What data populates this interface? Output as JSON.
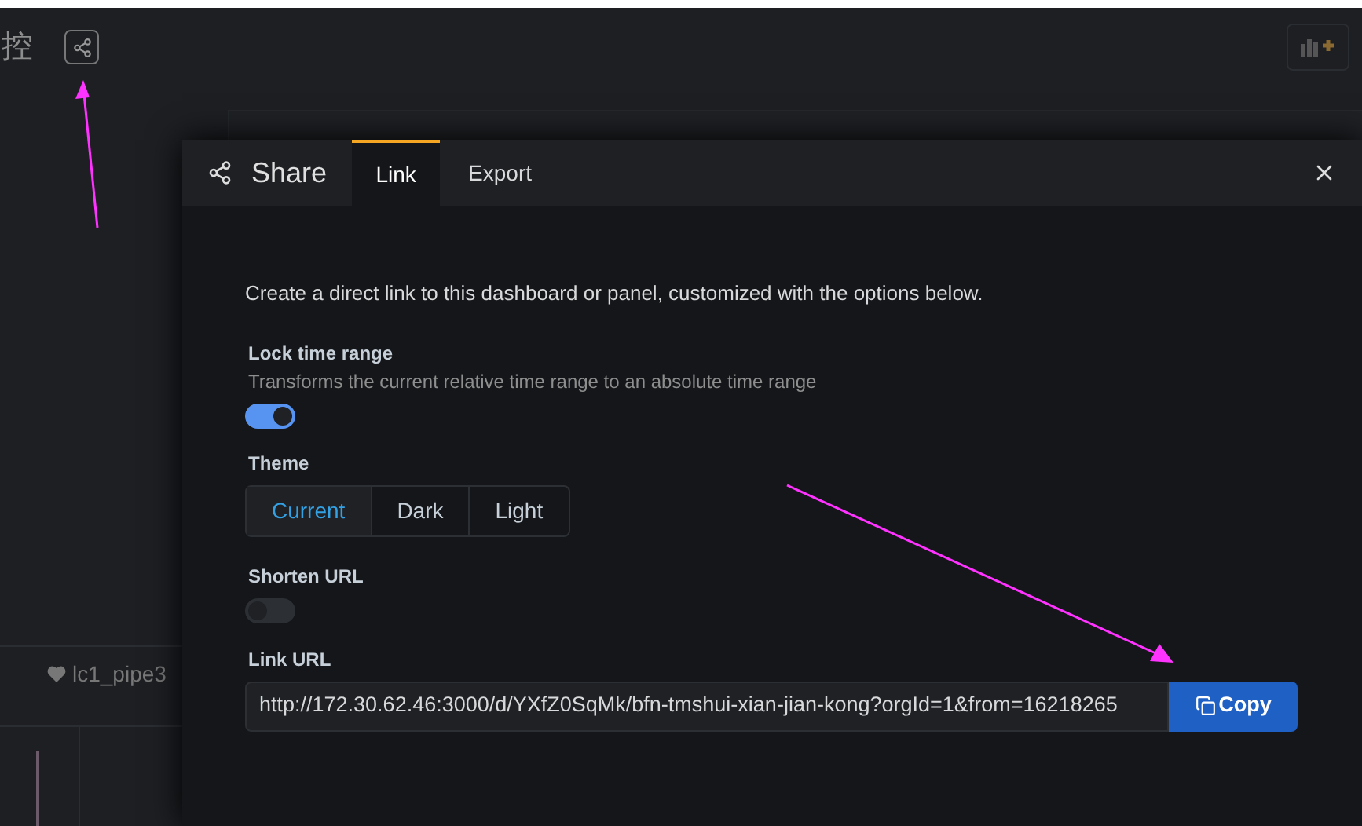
{
  "dashboard": {
    "title_fragment": "控",
    "legend_item": "lc1_pipe3"
  },
  "modal": {
    "title": "Share",
    "tabs": [
      {
        "label": "Link",
        "selected": true
      },
      {
        "label": "Export",
        "selected": false
      }
    ],
    "intro": "Create a direct link to this dashboard or panel, customized with the options below.",
    "lock_time_range": {
      "label": "Lock time range",
      "description": "Transforms the current relative time range to an absolute time range",
      "on": true
    },
    "theme": {
      "label": "Theme",
      "options": [
        {
          "label": "Current",
          "selected": true
        },
        {
          "label": "Dark",
          "selected": false
        },
        {
          "label": "Light",
          "selected": false
        }
      ]
    },
    "shorten_url": {
      "label": "Shorten URL",
      "on": false
    },
    "link_url": {
      "label": "Link URL",
      "value": "http://172.30.62.46:3000/d/YXfZ0SqMk/bfn-tmshui-xian-jian-kong?orgId=1&from=16218265",
      "button": "Copy"
    }
  }
}
